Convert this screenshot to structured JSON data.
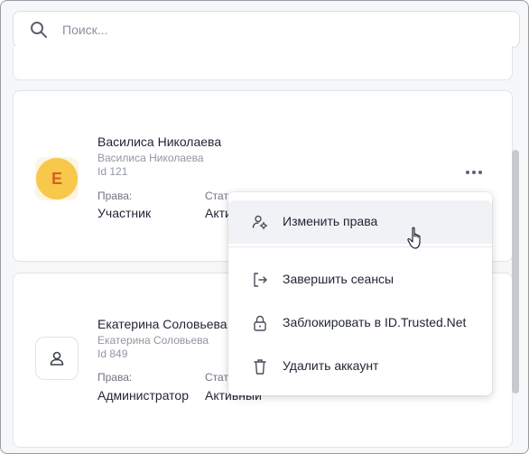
{
  "search": {
    "placeholder": "Поиск..."
  },
  "users": [
    {
      "name": "Василиса Николаева",
      "subname": "Василиса Николаева",
      "id_label": "Id 121",
      "avatar_letter": "Е",
      "rights_label": "Права:",
      "rights_value": "Участник",
      "status_label": "Стат",
      "status_value": "Акти"
    },
    {
      "name": "Екатерина Соловьева",
      "subname": "Екатерина Соловьева",
      "id_label": "Id 849",
      "rights_label": "Права:",
      "rights_value": "Администратор",
      "status_label": "Стат",
      "status_value": "Активный"
    }
  ],
  "menu": {
    "items": [
      {
        "label": "Изменить права",
        "icon": "user-settings-icon"
      },
      {
        "label": "Завершить сеансы",
        "icon": "logout-icon"
      },
      {
        "label": "Заблокировать в ID.Trusted.Net",
        "icon": "lock-icon"
      },
      {
        "label": "Удалить аккаунт",
        "icon": "trash-icon"
      }
    ]
  },
  "colors": {
    "avatar_bg": "#f8c84a",
    "avatar_letter": "#d3621f",
    "hover_bg": "#f1f2f5"
  }
}
